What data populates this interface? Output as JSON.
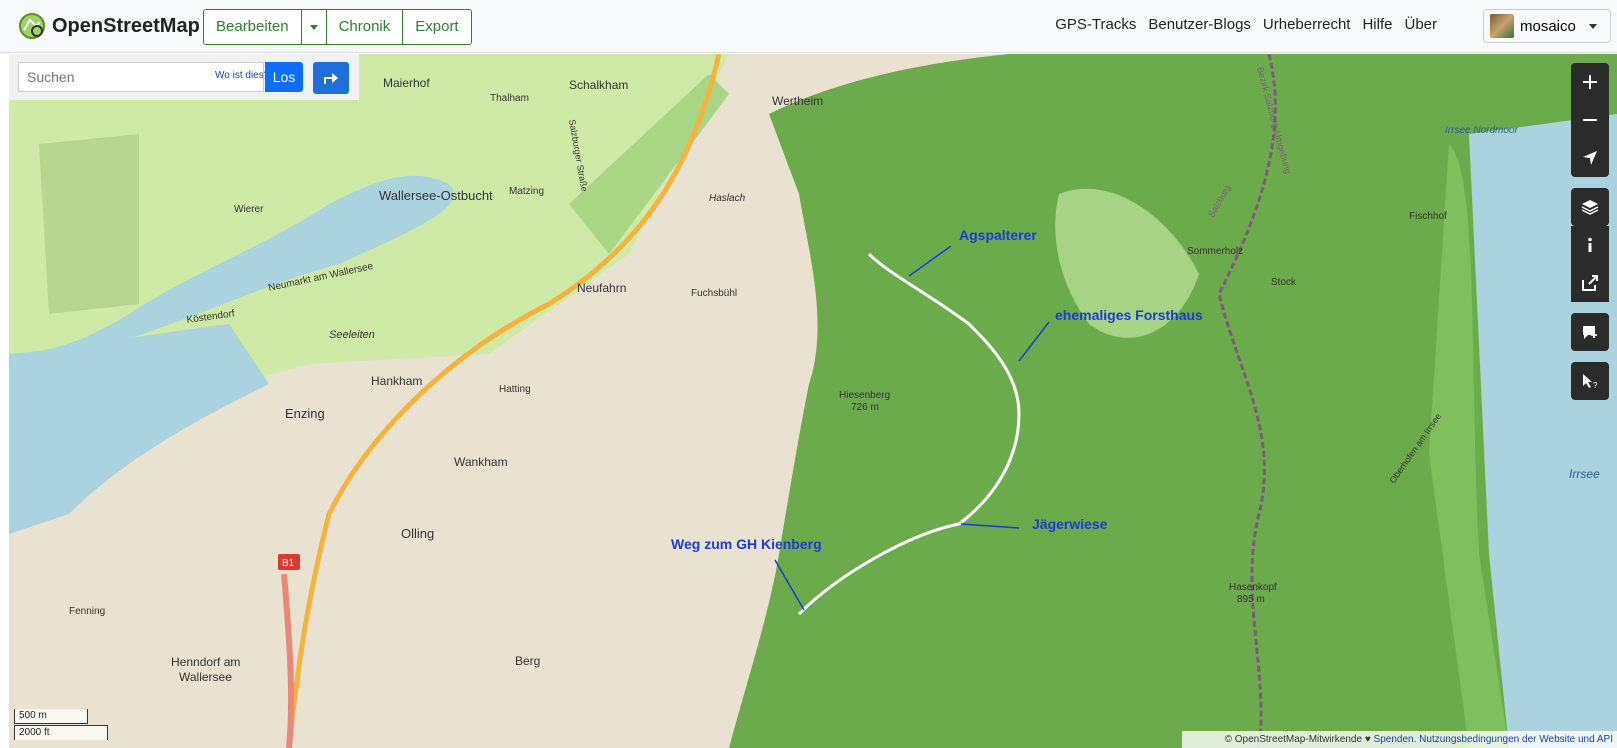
{
  "header": {
    "app_title": "OpenStreetMap",
    "edit_label": "Bearbeiten",
    "history_label": "Chronik",
    "export_label": "Export",
    "nav": [
      "GPS-Tracks",
      "Benutzer-Blogs",
      "Urheberrecht",
      "Hilfe",
      "Über"
    ],
    "username": "mosaico"
  },
  "search": {
    "placeholder": "Suchen",
    "whereis_label": "Wo ist dies?",
    "go_label": "Los"
  },
  "map": {
    "places": [
      "Maierhof",
      "Thalham",
      "Schalkham",
      "Wertheim",
      "Wierer",
      "Wallersee-Ostbucht",
      "Matzing",
      "Haslach",
      "Neufahrn",
      "Fuchsbühl",
      "Neumarkt am Wallersee",
      "Köstendorf",
      "Seeleiten",
      "Hankham",
      "Hatting",
      "Enzing",
      "Wankham",
      "Olling",
      "Fenning",
      "Henndorf am",
      "Wallersee",
      "Berg",
      "Hiesenberg",
      "726 m",
      "Sommerholz",
      "Stock",
      "Fischhof",
      "Irrsee Nordmoor",
      "Irrsee",
      "Oberhofen am Irrsee",
      "Hasenkopf",
      "895 m",
      "Salzburger Straße",
      "Bezirk Salzburg-Umgebung",
      "Salzburg",
      "B1"
    ],
    "annotations": [
      "Agspalterer",
      "ehemaliges Forsthaus",
      "Jägerwiese",
      "Weg zum GH Kienberg"
    ]
  },
  "controls": [
    "zoom-in-icon",
    "zoom-out-icon",
    "locate-icon",
    "layers-icon",
    "info-icon",
    "share-icon",
    "add-note-icon",
    "query-icon"
  ],
  "scale": {
    "metric": "500 m",
    "imperial": "2000 ft"
  },
  "attribution": {
    "prefix": "© OpenStreetMap-Mitwirkende ♥",
    "donate": "Spenden.",
    "terms": "Nutzungsbedingungen der Website und API"
  },
  "colors": {
    "accent": "#2e7d32",
    "forest": "#6cab4c",
    "water": "#aad3df",
    "annotation": "#1d3ad6"
  }
}
